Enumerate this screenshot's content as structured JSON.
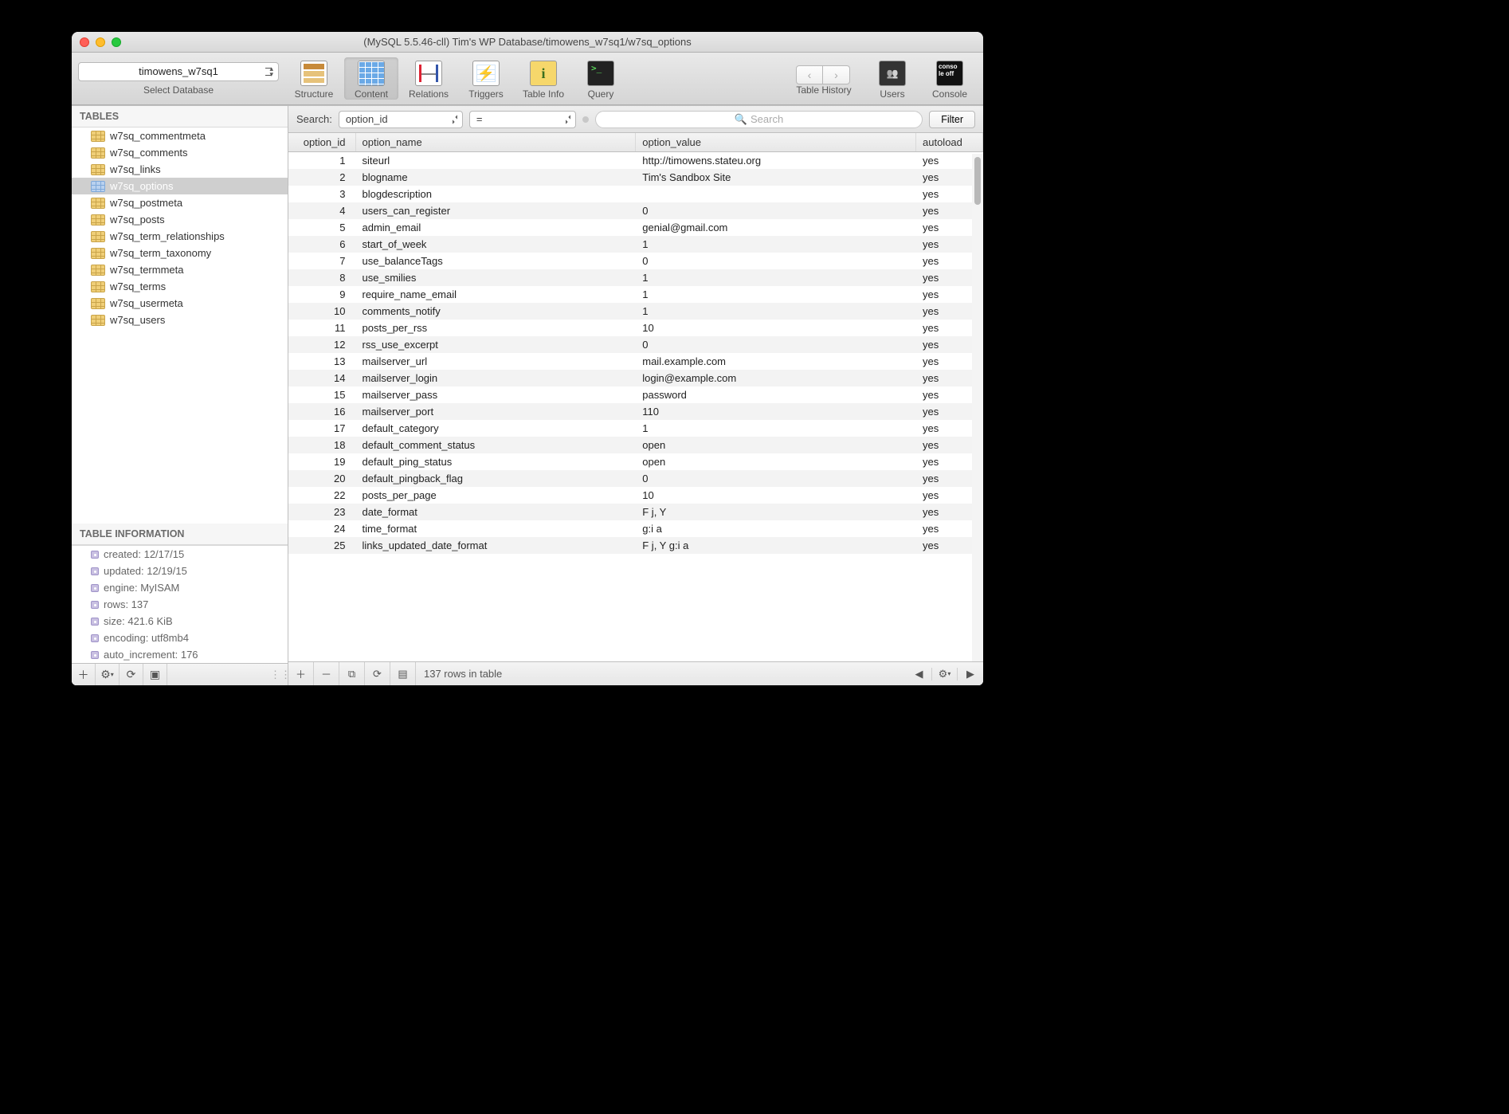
{
  "title": "(MySQL 5.5.46-cll) Tim's WP Database/timowens_w7sq1/w7sq_options",
  "database_selector": {
    "current": "timowens_w7sq1",
    "label": "Select Database"
  },
  "toolbar": {
    "structure": "Structure",
    "content": "Content",
    "relations": "Relations",
    "triggers": "Triggers",
    "tableinfo": "Table Info",
    "query": "Query",
    "history": "Table History",
    "users": "Users",
    "console": "Console"
  },
  "sidebar": {
    "tables_label": "TABLES",
    "tables": [
      "w7sq_commentmeta",
      "w7sq_comments",
      "w7sq_links",
      "w7sq_options",
      "w7sq_postmeta",
      "w7sq_posts",
      "w7sq_term_relationships",
      "w7sq_term_taxonomy",
      "w7sq_termmeta",
      "w7sq_terms",
      "w7sq_usermeta",
      "w7sq_users"
    ],
    "selected_index": 3,
    "info_label": "TABLE INFORMATION",
    "info": [
      "created: 12/17/15",
      "updated: 12/19/15",
      "engine: MyISAM",
      "rows: 137",
      "size: 421.6 KiB",
      "encoding: utf8mb4",
      "auto_increment: 176"
    ]
  },
  "search": {
    "label": "Search:",
    "column": "option_id",
    "operator": "=",
    "placeholder": "Search",
    "filter": "Filter"
  },
  "columns": [
    "option_id",
    "option_name",
    "option_value",
    "autoload"
  ],
  "rows": [
    {
      "id": "1",
      "name": "siteurl",
      "val": "http://timowens.stateu.org",
      "auto": "yes"
    },
    {
      "id": "2",
      "name": "blogname",
      "val": "Tim's Sandbox Site",
      "auto": "yes"
    },
    {
      "id": "3",
      "name": "blogdescription",
      "val": "",
      "auto": "yes"
    },
    {
      "id": "4",
      "name": "users_can_register",
      "val": "0",
      "auto": "yes"
    },
    {
      "id": "5",
      "name": "admin_email",
      "val": "genial@gmail.com",
      "auto": "yes"
    },
    {
      "id": "6",
      "name": "start_of_week",
      "val": "1",
      "auto": "yes"
    },
    {
      "id": "7",
      "name": "use_balanceTags",
      "val": "0",
      "auto": "yes"
    },
    {
      "id": "8",
      "name": "use_smilies",
      "val": "1",
      "auto": "yes"
    },
    {
      "id": "9",
      "name": "require_name_email",
      "val": "1",
      "auto": "yes"
    },
    {
      "id": "10",
      "name": "comments_notify",
      "val": "1",
      "auto": "yes"
    },
    {
      "id": "11",
      "name": "posts_per_rss",
      "val": "10",
      "auto": "yes"
    },
    {
      "id": "12",
      "name": "rss_use_excerpt",
      "val": "0",
      "auto": "yes"
    },
    {
      "id": "13",
      "name": "mailserver_url",
      "val": "mail.example.com",
      "auto": "yes"
    },
    {
      "id": "14",
      "name": "mailserver_login",
      "val": "login@example.com",
      "auto": "yes"
    },
    {
      "id": "15",
      "name": "mailserver_pass",
      "val": "password",
      "auto": "yes"
    },
    {
      "id": "16",
      "name": "mailserver_port",
      "val": "110",
      "auto": "yes"
    },
    {
      "id": "17",
      "name": "default_category",
      "val": "1",
      "auto": "yes"
    },
    {
      "id": "18",
      "name": "default_comment_status",
      "val": "open",
      "auto": "yes"
    },
    {
      "id": "19",
      "name": "default_ping_status",
      "val": "open",
      "auto": "yes"
    },
    {
      "id": "20",
      "name": "default_pingback_flag",
      "val": "0",
      "auto": "yes"
    },
    {
      "id": "22",
      "name": "posts_per_page",
      "val": "10",
      "auto": "yes"
    },
    {
      "id": "23",
      "name": "date_format",
      "val": "F j, Y",
      "auto": "yes"
    },
    {
      "id": "24",
      "name": "time_format",
      "val": "g:i a",
      "auto": "yes"
    },
    {
      "id": "25",
      "name": "links_updated_date_format",
      "val": "F j, Y g:i a",
      "auto": "yes"
    }
  ],
  "footer": {
    "status": "137 rows in table"
  }
}
